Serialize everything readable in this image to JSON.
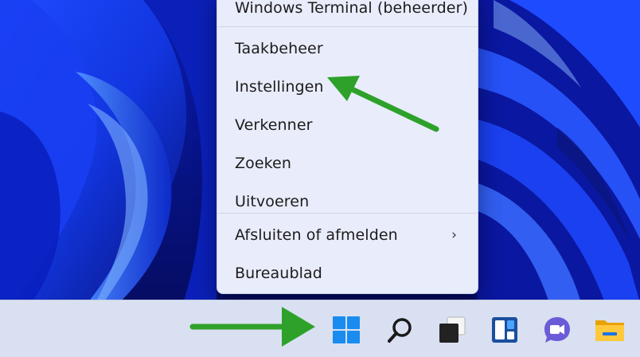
{
  "context_menu": {
    "items": [
      {
        "label": "Windows Terminal (beheerder)"
      },
      {
        "label": "Taakbeheer"
      },
      {
        "label": "Instellingen"
      },
      {
        "label": "Verkenner"
      },
      {
        "label": "Zoeken"
      },
      {
        "label": "Uitvoeren"
      },
      {
        "label": "Afsluiten of afmelden",
        "submenu": true,
        "arrow": "›"
      },
      {
        "label": "Bureaublad"
      }
    ]
  },
  "taskbar": {
    "icons": [
      {
        "name": "start-icon"
      },
      {
        "name": "search-icon"
      },
      {
        "name": "task-view-icon"
      },
      {
        "name": "widgets-icon"
      },
      {
        "name": "teams-chat-icon"
      },
      {
        "name": "file-explorer-icon"
      }
    ]
  },
  "colors": {
    "annotation_arrow": "#2ea12a",
    "wallpaper": "#1330e0",
    "taskbar": "#d9e0f1",
    "menu": "#e9ecfa"
  }
}
